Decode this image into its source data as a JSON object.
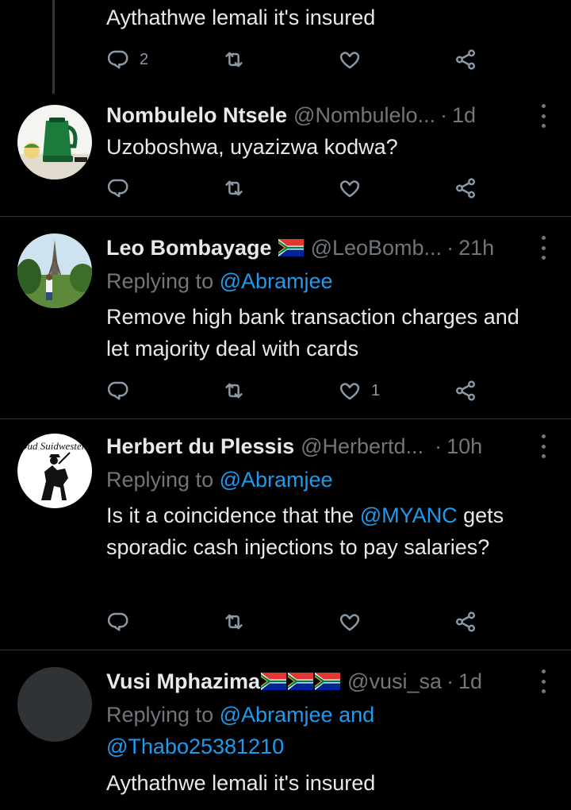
{
  "tweets": [
    {
      "name": "",
      "handle": "",
      "time": "",
      "replying_prefix": "",
      "replying_to": "",
      "text": "Aythathwe lemali it's insured",
      "reply_count": "2",
      "like_count": ""
    },
    {
      "name": "Nombulelo Ntsele",
      "handle": "@Nombulelo...",
      "time": "1d",
      "text": "Uzoboshwa, uyazizwa kodwa?",
      "reply_count": "",
      "like_count": ""
    },
    {
      "name": "Leo Bombayage",
      "name_flags": [
        "south-africa-flag"
      ],
      "handle": "@LeoBomb...",
      "time": "21h",
      "replying_prefix": "Replying to",
      "replying_to": "@Abramjee",
      "text": "Remove high bank transaction charges and let majority deal with cards",
      "reply_count": "",
      "like_count": "1"
    },
    {
      "name": "Herbert du Plessis",
      "handle": "@Herbertd...",
      "time": "10h",
      "replying_prefix": "Replying to",
      "replying_to": "@Abramjee",
      "avatar_text": "Oud Suidwesters",
      "text_before": "Is it a coincidence that the",
      "mention": "@MYANC",
      "text_after": "gets sporadic cash injections to pay salaries?",
      "reply_count": "",
      "like_count": ""
    },
    {
      "name": "Vusi Mphazima",
      "name_flags": [
        "south-africa-flag",
        "south-africa-flag",
        "south-africa-flag"
      ],
      "handle": "@vusi_sa",
      "time": "1d",
      "replying_prefix": "Replying to",
      "replying_to": "@Abramjee and",
      "replying_to_2": "@Thabo25381210",
      "text": "Aythathwe lemali it's insured"
    }
  ],
  "separator": "·",
  "colors": {
    "background": "#000000",
    "text": "#e7e9ea",
    "secondary": "#71767b",
    "link": "#1d9bf0",
    "divider": "#2f3336"
  }
}
